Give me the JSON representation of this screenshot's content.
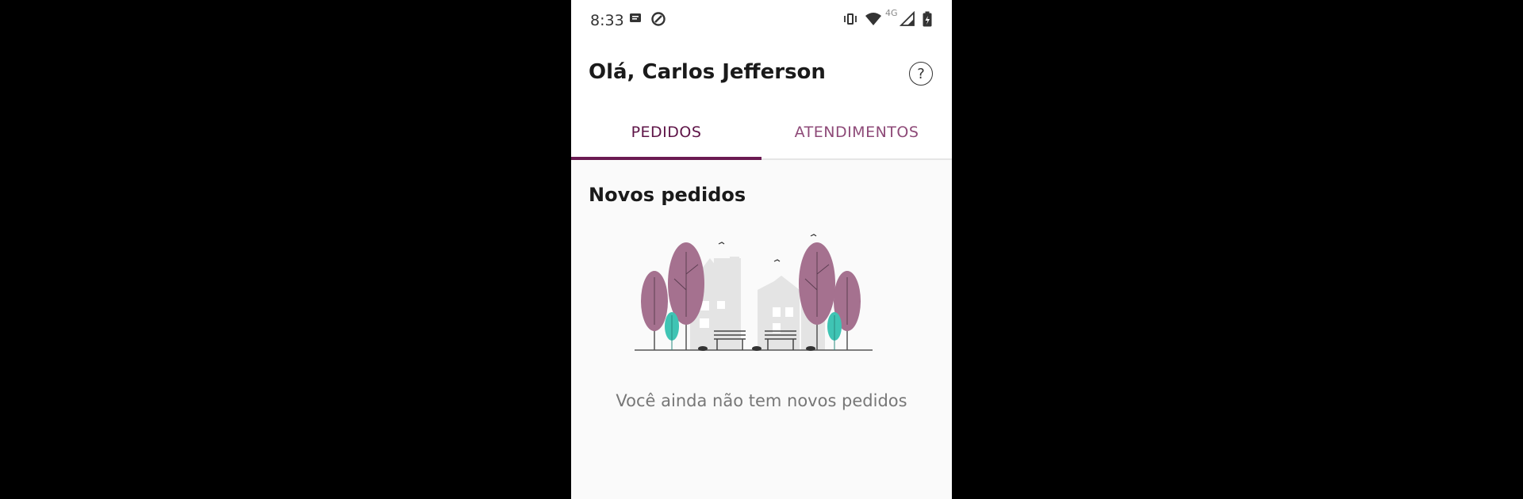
{
  "status_bar": {
    "time": "8:33",
    "network": "4G",
    "icons": [
      "message-icon",
      "data-saver-icon",
      "vibrate-icon",
      "wifi-icon",
      "signal-icon",
      "battery-icon"
    ]
  },
  "header": {
    "greeting": "Olá, Carlos Jefferson",
    "help_icon": "help-circle-icon",
    "help_label": "?"
  },
  "tabs": [
    {
      "label": "PEDIDOS",
      "active": true
    },
    {
      "label": "ATENDIMENTOS",
      "active": false
    }
  ],
  "main": {
    "section_title": "Novos pedidos",
    "empty_message": "Você ainda não tem novos pedidos"
  },
  "colors": {
    "accent": "#6b1a52",
    "tab_inactive": "#8e4a78",
    "tree": "#a5718f",
    "bush": "#3fc4b4"
  }
}
